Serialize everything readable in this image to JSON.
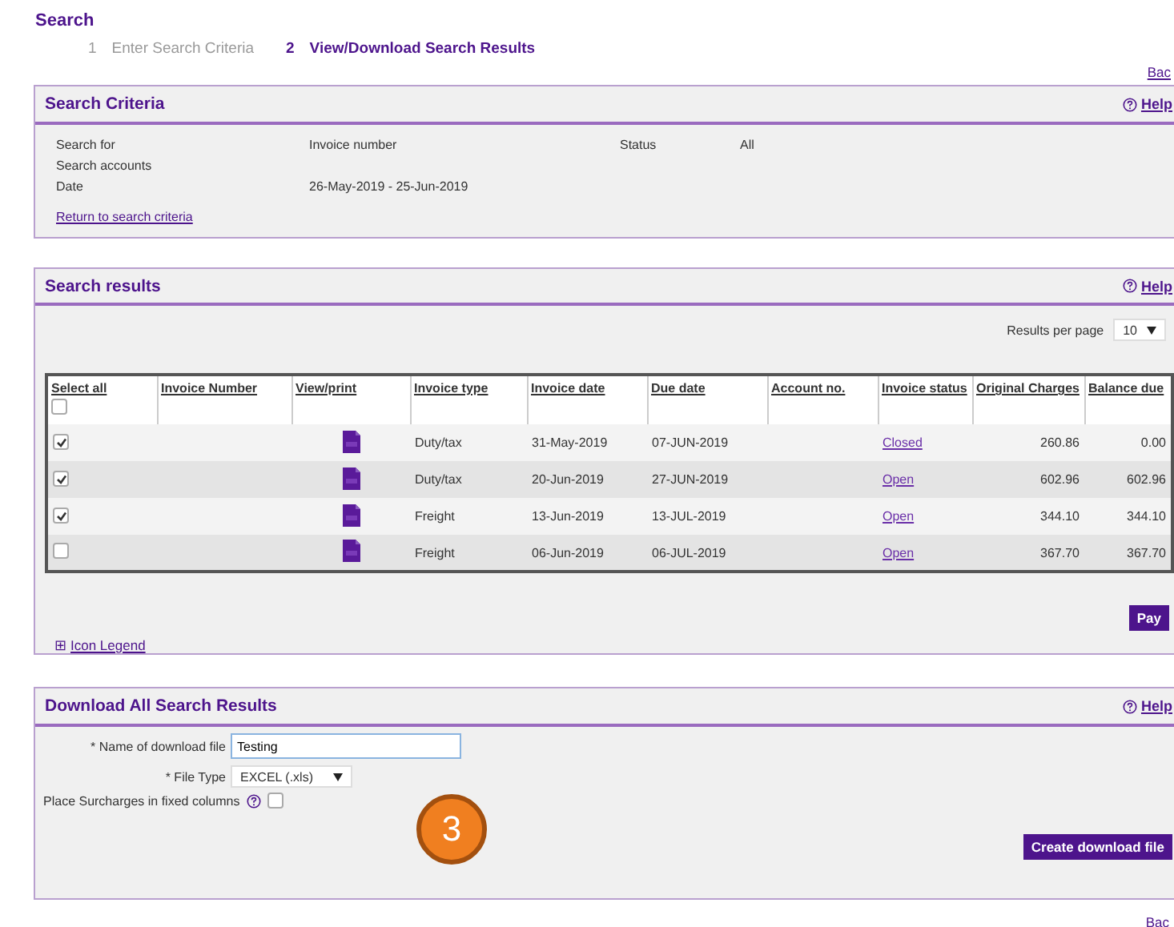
{
  "page_title": "Search",
  "steps": [
    {
      "number": "1",
      "label": "Enter Search Criteria",
      "selected": false
    },
    {
      "number": "2",
      "label": "View/Download Search Results",
      "selected": true
    }
  ],
  "back_link_top": "Bac",
  "criteria_panel": {
    "title": "Search Criteria",
    "help": "Help",
    "rows": [
      {
        "label": "Search for",
        "value": "Invoice number",
        "extra_label": "Status",
        "extra_value": "All"
      },
      {
        "label": "Search accounts",
        "value": ""
      },
      {
        "label": "Date",
        "value": "26-May-2019 - 25-Jun-2019"
      }
    ],
    "return_link": "Return to search criteria"
  },
  "results_panel": {
    "title": "Search results",
    "help": "Help",
    "per_page_label": "Results per page",
    "per_page_value": "10",
    "select_all_checked": false,
    "columns": [
      "Select all",
      "Invoice Number",
      "View/print",
      "Invoice type",
      "Invoice date",
      "Due date",
      "Account no.",
      "Invoice status",
      "Original Charges",
      "Balance due"
    ],
    "rows": [
      {
        "checked": true,
        "invoice_type": "Duty/tax",
        "invoice_date": "31-May-2019",
        "due_date": "07-JUN-2019",
        "status": "Closed",
        "original": "260.86",
        "balance": "0.00"
      },
      {
        "checked": true,
        "invoice_type": "Duty/tax",
        "invoice_date": "20-Jun-2019",
        "due_date": "27-JUN-2019",
        "status": "Open",
        "original": "602.96",
        "balance": "602.96"
      },
      {
        "checked": true,
        "invoice_type": "Freight",
        "invoice_date": "13-Jun-2019",
        "due_date": "13-JUL-2019",
        "status": "Open",
        "original": "344.10",
        "balance": "344.10"
      },
      {
        "checked": false,
        "invoice_type": "Freight",
        "invoice_date": "06-Jun-2019",
        "due_date": "06-JUL-2019",
        "status": "Open",
        "original": "367.70",
        "balance": "367.70"
      }
    ],
    "pay_button": "Pay",
    "legend_toggle": "⊞",
    "legend_link": "Icon Legend"
  },
  "download_panel": {
    "title": "Download All Search Results",
    "help": "Help",
    "name_label": "* Name of download file",
    "name_value": "Testing",
    "type_label": "* File Type",
    "type_value": "EXCEL (.xls)",
    "surcharge_label": "Place Surcharges in fixed columns",
    "surcharge_checked": false,
    "create_button": "Create download file"
  },
  "annotation_badge": "3",
  "back_link_bottom": "Bac"
}
